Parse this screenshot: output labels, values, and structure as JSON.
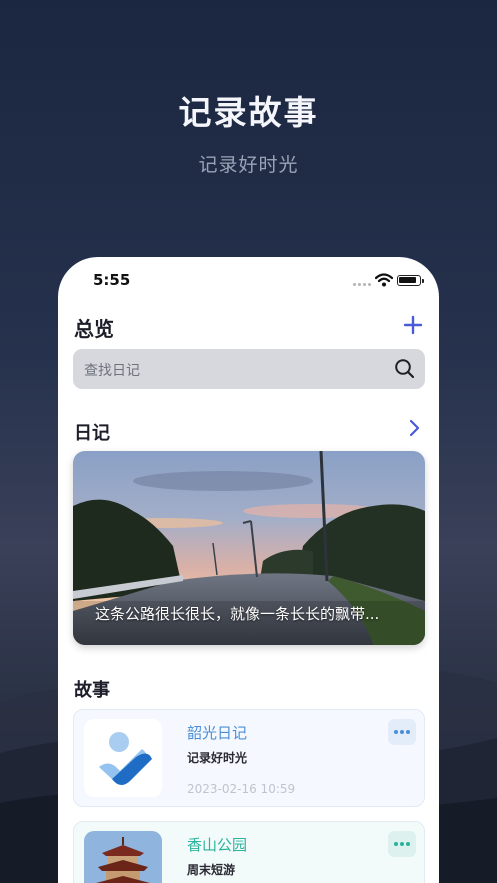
{
  "promo": {
    "title": "记录故事",
    "subtitle": "记录好时光"
  },
  "status_bar": {
    "time": "5:55"
  },
  "overview": {
    "title": "总览",
    "add_icon": "plus-icon"
  },
  "search": {
    "placeholder": "查找日记",
    "icon": "search-icon"
  },
  "diary": {
    "title": "日记",
    "more_icon": "chevron-right-icon",
    "card": {
      "caption": "这条公路很长很长，就像一条长长的飘带..."
    }
  },
  "stories": {
    "title": "故事",
    "items": [
      {
        "name": "韶光日记",
        "desc": "记录好时光",
        "date": "2023-02-16 10:59",
        "more_icon": "ellipsis-icon"
      },
      {
        "name": "香山公园",
        "desc": "周末短游",
        "more_icon": "ellipsis-icon"
      }
    ]
  },
  "colors": {
    "accent": "#4a5bd6",
    "story_blue": "#4a8fd6",
    "story_teal": "#2ab29c"
  }
}
